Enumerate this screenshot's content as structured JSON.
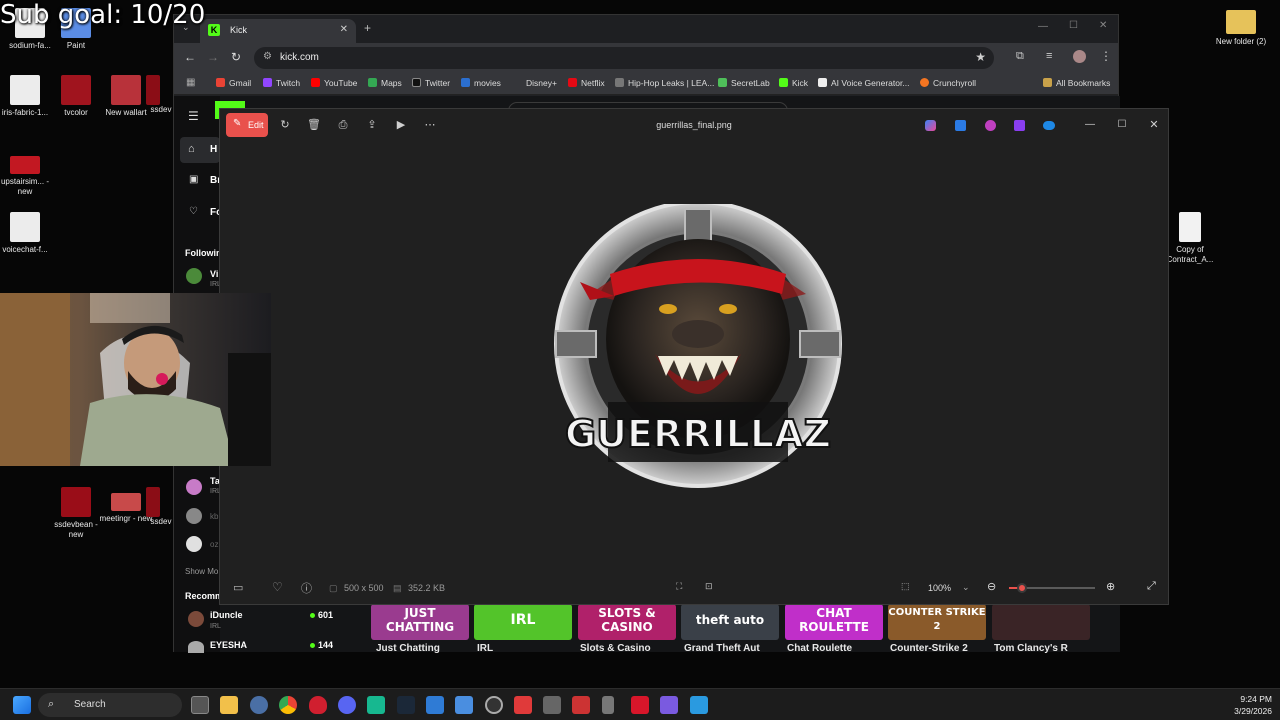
{
  "overlay": {
    "goal_text": "Sub goal: 10/20"
  },
  "desktop_icons": [
    {
      "label": "sodium-fa...",
      "color": "#e8e8e8"
    },
    {
      "label": "Paint",
      "color": "#5b8de6"
    },
    {
      "label": "iris-fabric-1...",
      "color": "#e8e8e8"
    },
    {
      "label": "tvcolor",
      "color": "#a0141e"
    },
    {
      "label": "New wallart",
      "color": "#b8323a"
    },
    {
      "label": "upstairsim... - new",
      "color": "#c21822"
    },
    {
      "label": "voicechat-f...",
      "color": "#e8e8e8"
    },
    {
      "label": "ssdevbean - new",
      "color": "#9a0d18"
    },
    {
      "label": "meetingr - new",
      "color": "#c84a4a"
    },
    {
      "label": "New folder (2)",
      "color": "#e6c25a"
    },
    {
      "label": "Copy of Contract_A...",
      "color": "#f2f2f2"
    },
    {
      "label": "ssdev",
      "color": "#8b0d16"
    },
    {
      "label": "new",
      "color": "#444444"
    }
  ],
  "browser": {
    "tab_title": "Kick",
    "tab_favicon": "K",
    "url": "kick.com",
    "bookmarks": [
      "Gmail",
      "Twitch",
      "YouTube",
      "Maps",
      "Twitter",
      "movies",
      "Disney+",
      "Netflix",
      "Hip-Hop Leaks | LEA...",
      "SecretLab",
      "Kick",
      "AI Voice Generator...",
      "Crunchyroll"
    ],
    "all_bookmarks": "All Bookmarks"
  },
  "kick": {
    "sidebar_nav": [
      "H",
      "Br",
      "Fo"
    ],
    "following_label": "Followin",
    "following": [
      {
        "name": "Vi",
        "sub": "IRL"
      },
      {
        "name": "Ta",
        "sub": "IRL"
      },
      {
        "name": "kb",
        "sub": ""
      },
      {
        "name": "oz",
        "sub": ""
      }
    ],
    "show_more": "Show Mo",
    "recommended_label": "Recomm",
    "recommended": [
      {
        "name": "iDuncle",
        "sub": "IRL",
        "viewers": "601"
      },
      {
        "name": "EYESHA",
        "sub": "",
        "viewers": "144"
      }
    ],
    "categories": [
      {
        "tile": "JUST CHATTING",
        "label": "Just Chatting",
        "color": "#9a3b8f"
      },
      {
        "tile": "IRL",
        "label": "IRL",
        "color": "#53c42a"
      },
      {
        "tile": "SLOTS & CASINO",
        "label": "Slots & Casino",
        "color": "#b0216a"
      },
      {
        "tile": "theft auto",
        "label": "Grand Theft Aut",
        "color": "#3a4048"
      },
      {
        "tile": "CHAT ROULETTE",
        "label": "Chat Roulette",
        "color": "#c02fc9"
      },
      {
        "tile": "COUNTER STRIKE 2",
        "label": "Counter-Strike 2",
        "color": "#8a5a2a"
      },
      {
        "tile": "",
        "label": "Tom Clancy's R",
        "color": "#3a2426"
      }
    ]
  },
  "viewer": {
    "edit_label": "Edit",
    "filename": "guerrillas_final.png",
    "dimensions": "500 x 500",
    "file_size": "352.2 KB",
    "zoom": "100%",
    "image_text": "GUERRILLAZ",
    "zoom_slider_fraction": 0.15
  },
  "taskbar": {
    "search_placeholder": "Search",
    "time": "9:24 PM",
    "date": "3/29/2026"
  }
}
